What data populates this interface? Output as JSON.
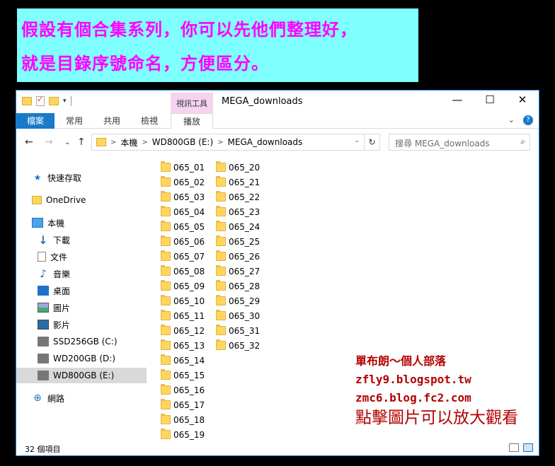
{
  "banner": {
    "line1": "假設有個合集系列，你可以先他們整理好，",
    "line2": "就是目錄序號命名，方便區分。"
  },
  "window": {
    "title": "MEGA_downloads",
    "context_tab": "視訊工具",
    "minimize": "—",
    "maximize": "☐",
    "close": "✕"
  },
  "ribbon": {
    "file_tab": "檔案",
    "tabs": [
      "常用",
      "共用",
      "檢視"
    ],
    "play_tab": "播放",
    "expand": "⌄",
    "help": "?"
  },
  "address": {
    "segments": [
      "本機",
      "WD800GB (E:)",
      "MEGA_downloads"
    ],
    "search_placeholder": "搜尋 MEGA_downloads",
    "back": "←",
    "forward": "→",
    "recent": "⌄",
    "up": "↑",
    "refresh": "↻",
    "search_icon": "⌕",
    "dropdown": "⌄"
  },
  "nav": [
    {
      "label": "快速存取",
      "icon": "star-icon"
    },
    {
      "label": "OneDrive",
      "icon": "folder-icon"
    },
    {
      "label": "本機",
      "icon": "computer-icon"
    },
    {
      "label": "下載",
      "icon": "download-icon"
    },
    {
      "label": "文件",
      "icon": "document-icon"
    },
    {
      "label": "音樂",
      "icon": "music-icon"
    },
    {
      "label": "桌面",
      "icon": "desktop-icon"
    },
    {
      "label": "圖片",
      "icon": "picture-icon"
    },
    {
      "label": "影片",
      "icon": "video-icon"
    },
    {
      "label": "SSD256GB (C:)",
      "icon": "drive-icon"
    },
    {
      "label": "WD200GB (D:)",
      "icon": "drive-icon"
    },
    {
      "label": "WD800GB (E:)",
      "icon": "drive-icon"
    },
    {
      "label": "網路",
      "icon": "network-icon"
    }
  ],
  "files": [
    "065_01",
    "065_02",
    "065_03",
    "065_04",
    "065_05",
    "065_06",
    "065_07",
    "065_08",
    "065_09",
    "065_10",
    "065_11",
    "065_12",
    "065_13",
    "065_14",
    "065_15",
    "065_16",
    "065_17",
    "065_18",
    "065_19",
    "065_20",
    "065_21",
    "065_22",
    "065_23",
    "065_24",
    "065_25",
    "065_26",
    "065_27",
    "065_28",
    "065_29",
    "065_30",
    "065_31",
    "065_32"
  ],
  "status": {
    "count_text": "32 個項目"
  },
  "watermark": {
    "line1": "單布朗～個人部落",
    "line2": "zfly9.blogspot.tw",
    "line3": "zmc6.blog.fc2.com",
    "line4": "點擊圖片可以放大觀看"
  },
  "colors": {
    "accent": "#1979ca",
    "banner_bg": "#80ffff",
    "banner_text": "#ff00ff",
    "watermark": "#b30000"
  }
}
